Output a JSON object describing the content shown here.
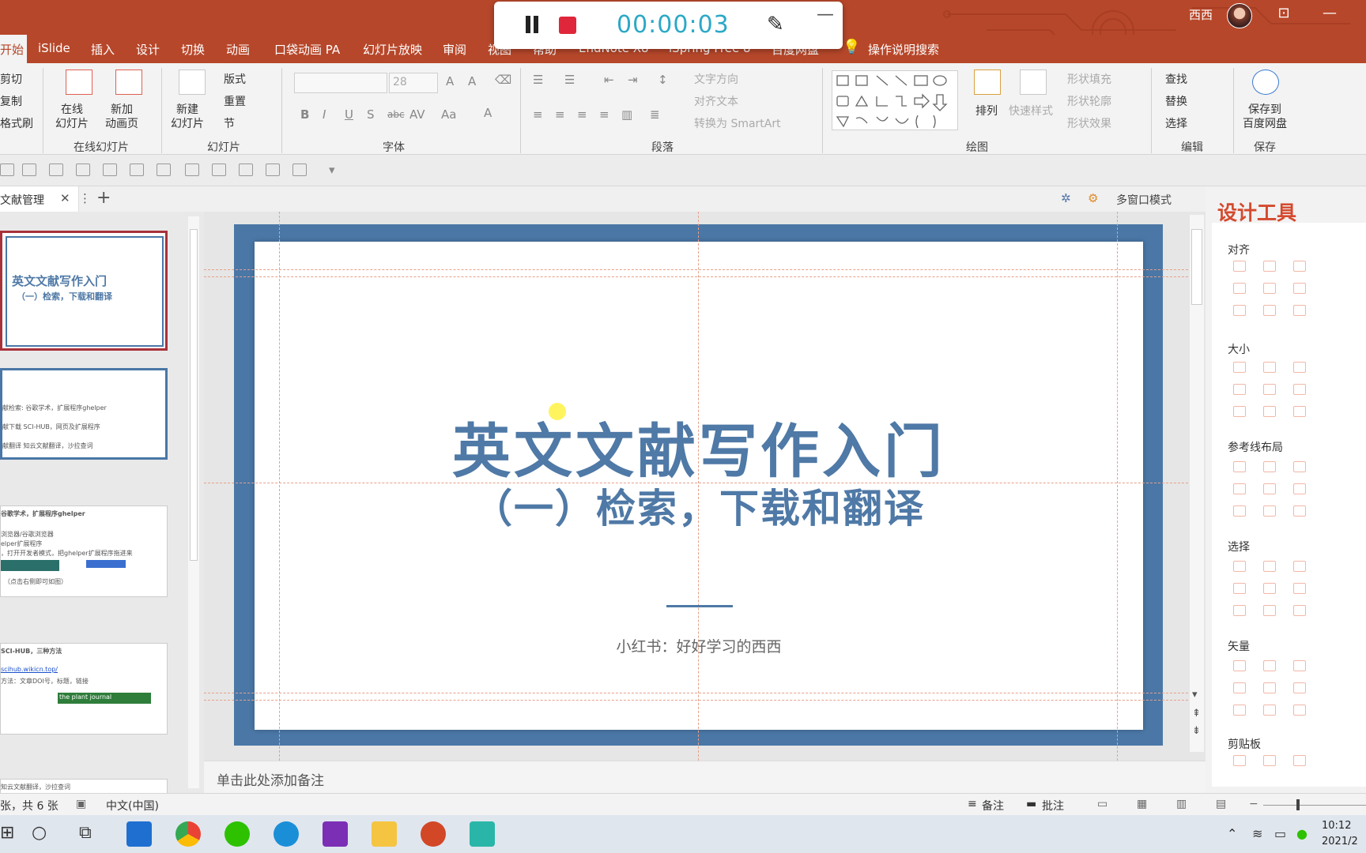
{
  "window": {
    "user_name": "西西"
  },
  "recorder": {
    "time": "00:00:03"
  },
  "ribbon_tabs": [
    "开始",
    "iSlide",
    "插入",
    "设计",
    "切换",
    "动画",
    "口袋动画 PA",
    "幻灯片放映",
    "审阅",
    "视图",
    "帮助",
    "EndNote X8",
    "iSpring Free 8",
    "百度网盘",
    "操作说明搜索"
  ],
  "ribbon": {
    "clipboard": {
      "cut": "剪切",
      "copy": "复制",
      "format_painter": "格式刷"
    },
    "online": {
      "online_slides": "在线\n幻灯片",
      "new_anim_page": "新加\n动画页",
      "group": "在线幻灯片"
    },
    "slides": {
      "new_slide": "新建\n幻灯片",
      "layout": "版式",
      "reset": "重置",
      "section": "节",
      "group": "幻灯片"
    },
    "font": {
      "size": "28",
      "group": "字体"
    },
    "paragraph": {
      "text_direction": "文字方向",
      "align_text": "对齐文本",
      "smartart": "转换为 SmartArt",
      "group": "段落"
    },
    "drawing": {
      "arrange": "排列",
      "quick_styles": "快速样式",
      "shape_fill": "形状填充",
      "shape_outline": "形状轮廓",
      "shape_effects": "形状效果",
      "group": "绘图"
    },
    "editing": {
      "find": "查找",
      "replace": "替换",
      "select": "选择",
      "group": "编辑"
    },
    "save": {
      "save_baidu": "保存到\n百度网盘",
      "group": "保存"
    }
  },
  "doc_tab": {
    "label": "文献管理",
    "multi_window": "多窗口模式"
  },
  "slides_panel": {
    "thumb1": {
      "title": "英文文献写作入门",
      "subtitle": "（一）检索，下载和翻译"
    },
    "thumb2": {
      "lines": [
        "献检索: 谷歌学术，扩展程序ghelper",
        "献下载 SCI-HUB，网页及扩展程序",
        "献翻译 知云文献翻译，沙拉查词"
      ]
    },
    "thumb3": {
      "header": "谷歌学术，扩展程序ghelper",
      "lines": [
        "浏览器/谷歌浏览器",
        "elper扩展程序",
        "，打开开发者模式，把ghelper扩展程序拖进来"
      ],
      "footer": "（点击右侧即可如图）"
    },
    "thumb4": {
      "header": "SCI-HUB，三种方法",
      "link": "scihub.wikicn.top/",
      "lines": [
        "方法：文章DOI号，标题，链接"
      ],
      "journal": "the plant journal"
    },
    "thumb5": {
      "header": "知云文献翻译，沙拉查词"
    }
  },
  "slide": {
    "title": "英文文献写作入门",
    "subtitle": "（一）检索，下载和翻译",
    "author": "小红书：好好学习的西西",
    "title_color": "#4f79a6",
    "frame_color": "#4a77a6"
  },
  "notes": {
    "placeholder": "单击此处添加备注"
  },
  "design_tools": {
    "title": "设计工具",
    "sections": [
      "对齐",
      "大小",
      "参考线布局",
      "选择",
      "矢量",
      "剪贴板"
    ]
  },
  "status": {
    "slide_count": "张，共 6 张",
    "language": "中文(中国)",
    "notes_btn": "备注",
    "comments_btn": "批注"
  },
  "taskbar": {
    "time": "10:12",
    "date": "2021/2"
  },
  "colors": {
    "accent": "#b7472a",
    "design_title": "#d44a2e"
  }
}
